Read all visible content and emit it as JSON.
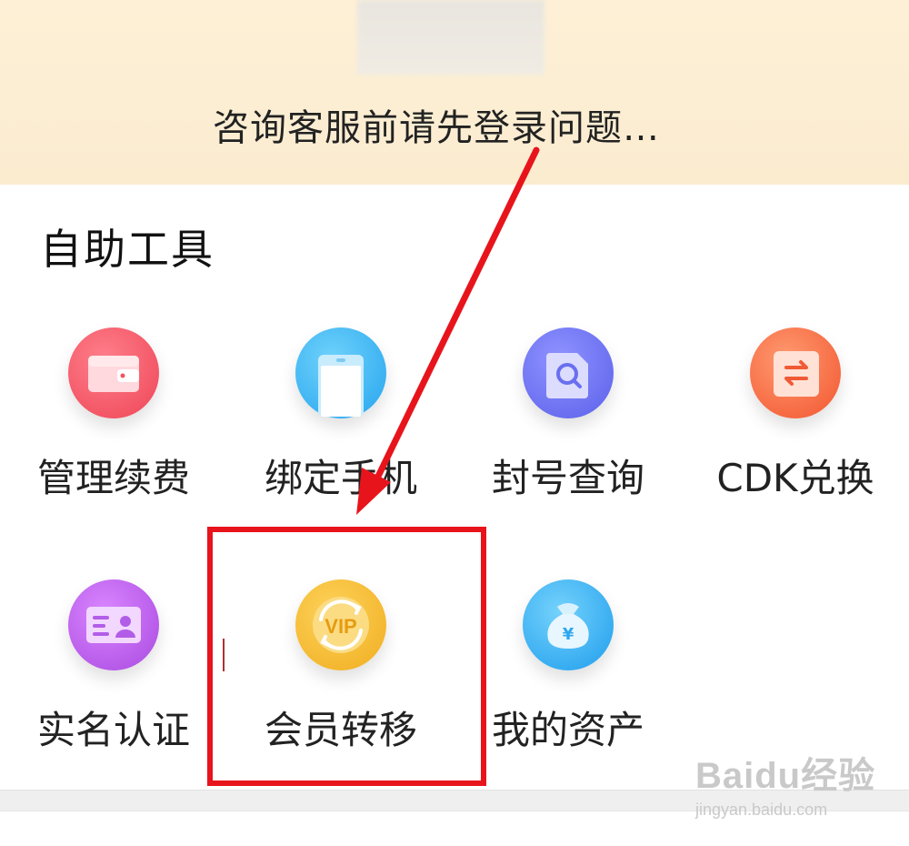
{
  "header": {
    "notice": "咨询客服前请先登录问题…"
  },
  "section": {
    "title": "自助工具"
  },
  "tools": [
    {
      "label": "管理续费",
      "icon": "wallet-icon",
      "color": "#f0535f"
    },
    {
      "label": "绑定手机",
      "icon": "phone-icon",
      "color": "#3bb4f2"
    },
    {
      "label": "封号查询",
      "icon": "search-document-icon",
      "color": "#6b6ff0"
    },
    {
      "label": "CDK兑换",
      "icon": "exchange-icon",
      "color": "#f5673e"
    },
    {
      "label": "实名认证",
      "icon": "id-card-icon",
      "color": "#b456e4"
    },
    {
      "label": "会员转移",
      "icon": "vip-transfer-icon",
      "color": "#f4b62a"
    },
    {
      "label": "我的资产",
      "icon": "money-bag-icon",
      "color": "#2ea7ee"
    }
  ],
  "annotation": {
    "highlight_color": "#e8141c"
  },
  "watermark": {
    "logo": "Baidu经验",
    "url": "jingyan.baidu.com"
  }
}
